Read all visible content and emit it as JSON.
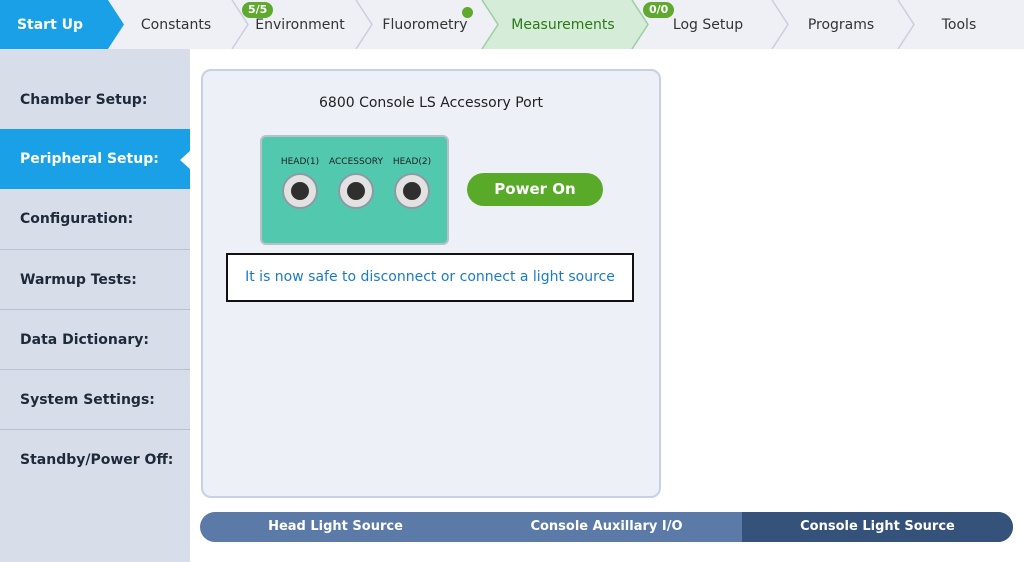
{
  "nav": {
    "tabs": [
      {
        "label": "Start Up"
      },
      {
        "label": "Constants"
      },
      {
        "label": "Environment",
        "badge": "5/5"
      },
      {
        "label": "Fluorometry",
        "status": "active"
      },
      {
        "label": "Measurements"
      },
      {
        "label": "Log Setup",
        "badge": "0/0"
      },
      {
        "label": "Programs"
      },
      {
        "label": "Tools"
      }
    ]
  },
  "sidebar": {
    "items": [
      {
        "label": "Chamber Setup:"
      },
      {
        "label": "Peripheral Setup:",
        "selected": true
      },
      {
        "label": "Configuration:"
      },
      {
        "label": "Warmup Tests:"
      },
      {
        "label": "Data Dictionary:"
      },
      {
        "label": "System Settings:"
      },
      {
        "label": "Standby/Power Off:"
      }
    ]
  },
  "panel": {
    "title": "6800 Console LS Accessory Port",
    "ports": [
      "HEAD(1)",
      "ACCESSORY",
      "HEAD(2)"
    ],
    "power_button": "Power On",
    "message": "It is now safe to disconnect or connect a light source"
  },
  "bottom_tabs": {
    "items": [
      "Head Light Source",
      "Console Auxillary I/O",
      "Console Light Source"
    ],
    "active": "Console Light Source"
  },
  "colors": {
    "accent_blue": "#1aa0e6",
    "green": "#5aaa2a",
    "port_box": "#52c8ae",
    "current_tab_bg": "#d4ecd8",
    "segment_active": "#34527a"
  }
}
